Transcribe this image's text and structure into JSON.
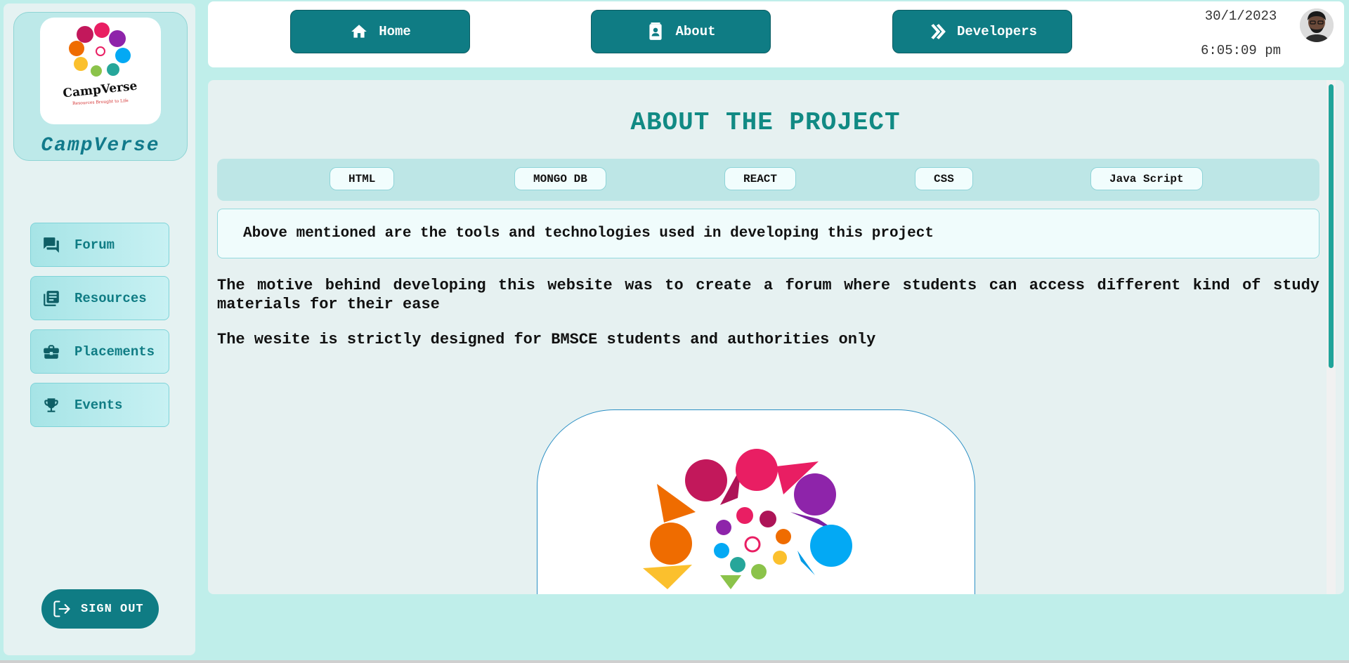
{
  "brand": {
    "name": "CampVerse",
    "logo_text": "CampVerse",
    "logo_tagline": "Resources Brought to Life"
  },
  "sidebar": {
    "items": [
      {
        "label": "Forum",
        "icon": "forum-icon"
      },
      {
        "label": "Resources",
        "icon": "library-books-icon"
      },
      {
        "label": "Placements",
        "icon": "briefcase-icon"
      },
      {
        "label": "Events",
        "icon": "trophy-icon"
      }
    ],
    "signout_label": "SIGN OUT"
  },
  "topbar": {
    "buttons": [
      {
        "label": "Home",
        "icon": "home-icon"
      },
      {
        "label": "About",
        "icon": "contact-card-icon"
      },
      {
        "label": "Developers",
        "icon": "double-chevron-right-icon"
      }
    ],
    "date": "30/1/2023",
    "time": "6:05:09 pm"
  },
  "main": {
    "title": "ABOUT THE PROJECT",
    "technologies": [
      "HTML",
      "MONGO DB",
      "REACT",
      "CSS",
      "Java Script"
    ],
    "note": "Above mentioned are the tools and technologies used in developing this project",
    "paragraphs": [
      "The motive behind developing this website was to create a forum where students can access different kind of study materials for their ease",
      "The wesite is strictly designed for BMSCE students and authorities only"
    ]
  },
  "colors": {
    "primary": "#0f7c84",
    "title": "#118a84",
    "background": "#bfeeea",
    "panel": "#e6f1f1"
  }
}
